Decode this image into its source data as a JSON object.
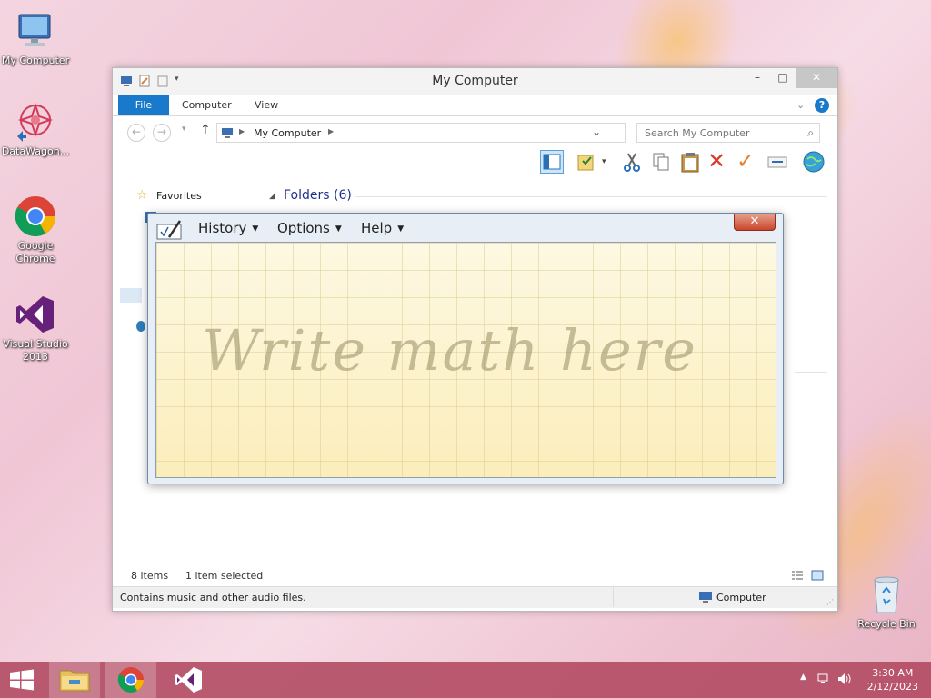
{
  "desktop": {
    "icons": [
      {
        "label": "My Computer"
      },
      {
        "label": "DataWagon..."
      },
      {
        "label": "Google Chrome"
      },
      {
        "label": "Visual Studio 2013"
      },
      {
        "label": "Recycle Bin"
      }
    ]
  },
  "explorer": {
    "title": "My Computer",
    "tabs": {
      "file": "File",
      "computer": "Computer",
      "view": "View"
    },
    "address": {
      "crumb": "My Computer"
    },
    "search": {
      "placeholder": "Search My Computer"
    },
    "nav": {
      "favorites": "Favorites"
    },
    "folders_header": "Folders (6)",
    "status": {
      "items": "8 items",
      "selected": "1 item selected",
      "description": "Contains music and other audio files.",
      "location": "Computer"
    }
  },
  "math_panel": {
    "menu": {
      "history": "History",
      "options": "Options",
      "help": "Help"
    },
    "placeholder": "Write math here",
    "close_glyph": "✕"
  },
  "taskbar": {
    "clock": {
      "time": "3:30 AM",
      "date": "2/12/2023"
    }
  },
  "colors": {
    "file_tab": "#1979ca",
    "taskbar": "#b04860",
    "math_close": "#c9462c"
  }
}
